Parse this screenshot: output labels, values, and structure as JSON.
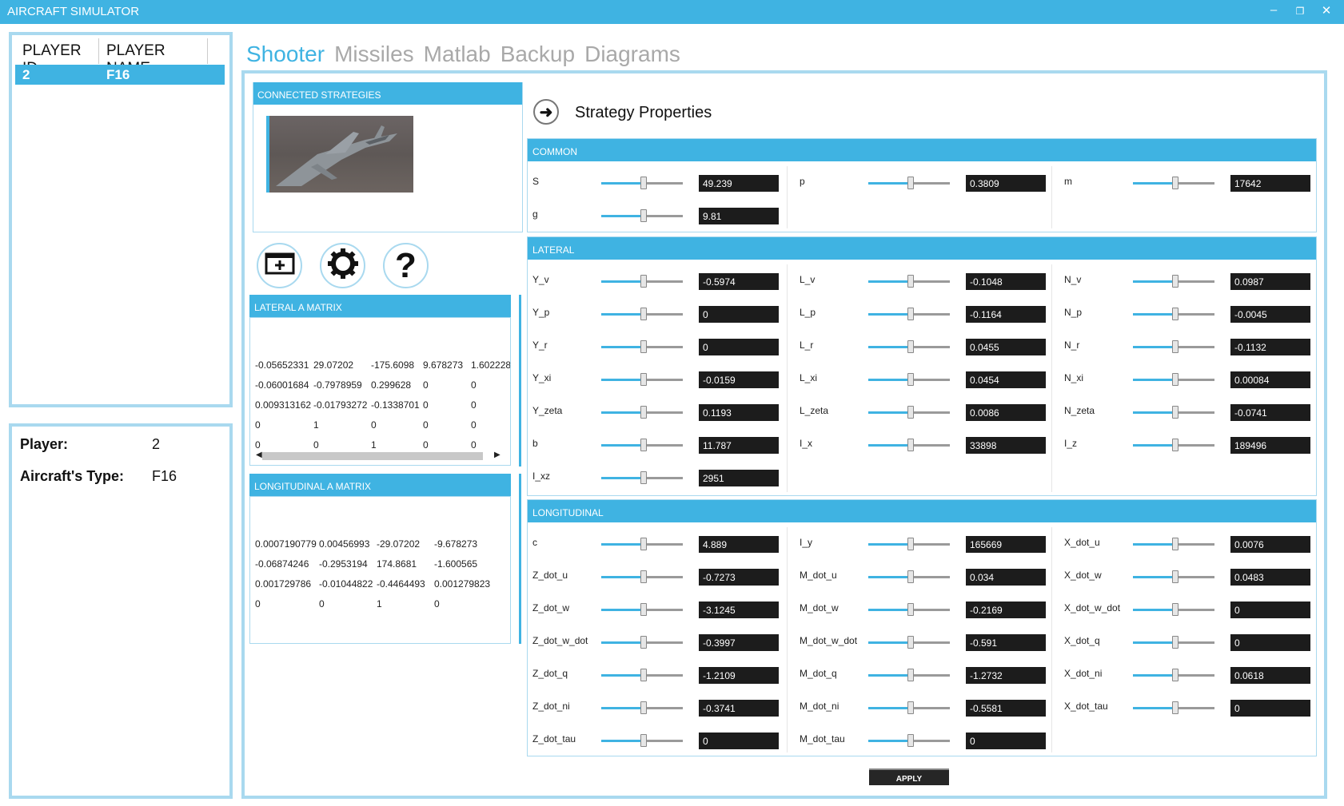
{
  "window": {
    "title": "AIRCRAFT SIMULATOR",
    "min_icon": "minimize-icon",
    "restore_icon": "restore-icon",
    "close_icon": "close-icon",
    "accent": "#3fb3e2",
    "border": "#a9d9ef"
  },
  "players_table": {
    "headers": [
      "PLAYER ID",
      "PLAYER NAME"
    ],
    "rows": [
      {
        "id": "2",
        "name": "F16"
      }
    ]
  },
  "player_info": {
    "player_label": "Player:",
    "player_value": "2",
    "type_label": "Aircraft's Type:",
    "type_value": "F16"
  },
  "tabs": [
    "Shooter",
    "Missiles",
    "Matlab",
    "Backup",
    "Diagrams"
  ],
  "active_tab": "Shooter",
  "connected_strategies": {
    "title": "CONNECTED STRATEGIES",
    "image": "f16-aircraft-image"
  },
  "action_buttons": [
    "add-window-icon",
    "gear-icon",
    "question-icon"
  ],
  "lateral_matrix": {
    "title": "LATERAL A MATRIX",
    "rows": [
      [
        "-0.05652331",
        "29.07202",
        "-175.6098",
        "9.678273",
        "1.602228"
      ],
      [
        "-0.06001684",
        "-0.7978959",
        "0.299628",
        "0",
        "0"
      ],
      [
        "0.009313162",
        "-0.01793272",
        "-0.1338701",
        "0",
        "0"
      ],
      [
        "0",
        "1",
        "0",
        "0",
        "0"
      ],
      [
        "0",
        "0",
        "1",
        "0",
        "0"
      ]
    ]
  },
  "longitudinal_matrix": {
    "title": "LONGITUDINAL A MATRIX",
    "rows": [
      [
        "0.0007190779",
        "0.00456993",
        "-29.07202",
        "-9.678273"
      ],
      [
        "-0.06874246",
        "-0.2953194",
        "174.8681",
        "-1.600565"
      ],
      [
        "0.001729786",
        "-0.01044822",
        "-0.4464493",
        "0.001279823"
      ],
      [
        "0",
        "0",
        "1",
        "0"
      ]
    ]
  },
  "strategy_properties": {
    "title": "Strategy Properties",
    "icon": "arrow-right-icon"
  },
  "common": {
    "title": "COMMON",
    "params": [
      {
        "label": "S",
        "value": "49.239"
      },
      {
        "label": "p",
        "value": "0.3809"
      },
      {
        "label": "m",
        "value": "17642"
      },
      {
        "label": "g",
        "value": "9.81"
      }
    ]
  },
  "lateral": {
    "title": "LATERAL",
    "params": [
      {
        "label": "Y_v",
        "value": "-0.5974"
      },
      {
        "label": "L_v",
        "value": "-0.1048"
      },
      {
        "label": "N_v",
        "value": "0.0987"
      },
      {
        "label": "Y_p",
        "value": "0"
      },
      {
        "label": "L_p",
        "value": "-0.1164"
      },
      {
        "label": "N_p",
        "value": "-0.0045"
      },
      {
        "label": "Y_r",
        "value": "0"
      },
      {
        "label": "L_r",
        "value": "0.0455"
      },
      {
        "label": "N_r",
        "value": "-0.1132"
      },
      {
        "label": "Y_xi",
        "value": "-0.0159"
      },
      {
        "label": "L_xi",
        "value": "0.0454"
      },
      {
        "label": "N_xi",
        "value": "0.00084"
      },
      {
        "label": "Y_zeta",
        "value": "0.1193"
      },
      {
        "label": "L_zeta",
        "value": "0.0086"
      },
      {
        "label": "N_zeta",
        "value": "-0.0741"
      },
      {
        "label": "b",
        "value": "11.787"
      },
      {
        "label": "I_x",
        "value": "33898"
      },
      {
        "label": "I_z",
        "value": "189496"
      },
      {
        "label": "I_xz",
        "value": "2951"
      }
    ]
  },
  "longitudinal": {
    "title": "LONGITUDINAL",
    "params": [
      {
        "label": "c",
        "value": "4.889"
      },
      {
        "label": "I_y",
        "value": "165669"
      },
      {
        "label": "X_dot_u",
        "value": "0.0076"
      },
      {
        "label": "Z_dot_u",
        "value": "-0.7273"
      },
      {
        "label": "M_dot_u",
        "value": "0.034"
      },
      {
        "label": "X_dot_w",
        "value": "0.0483"
      },
      {
        "label": "Z_dot_w",
        "value": "-3.1245"
      },
      {
        "label": "M_dot_w",
        "value": "-0.2169"
      },
      {
        "label": "X_dot_w_dot",
        "value": "0"
      },
      {
        "label": "Z_dot_w_dot",
        "value": "-0.3997"
      },
      {
        "label": "M_dot_w_dot",
        "value": "-0.591"
      },
      {
        "label": "X_dot_q",
        "value": "0"
      },
      {
        "label": "Z_dot_q",
        "value": "-1.2109"
      },
      {
        "label": "M_dot_q",
        "value": "-1.2732"
      },
      {
        "label": "X_dot_ni",
        "value": "0.0618"
      },
      {
        "label": "Z_dot_ni",
        "value": "-0.3741"
      },
      {
        "label": "M_dot_ni",
        "value": "-0.5581"
      },
      {
        "label": "X_dot_tau",
        "value": "0"
      },
      {
        "label": "Z_dot_tau",
        "value": "0"
      },
      {
        "label": "M_dot_tau",
        "value": "0"
      }
    ]
  },
  "apply_label": "APPLY"
}
